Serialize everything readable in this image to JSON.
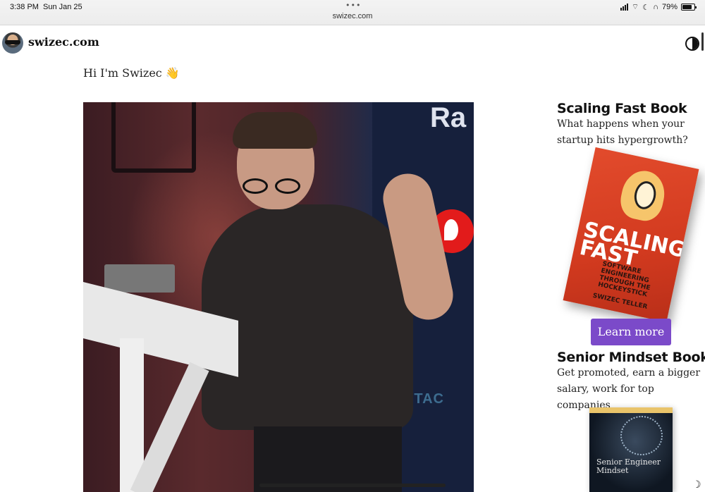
{
  "statusbar": {
    "time": "3:38 PM",
    "date": "Sun Jan 25",
    "dots": "•••",
    "url": "swizec.com",
    "battery_percent": "79%",
    "battery_level": 0.79
  },
  "header": {
    "site_name": "swizec.com",
    "avatar_icon": "avatar-photo",
    "theme_icon": "contrast-toggle-icon"
  },
  "main": {
    "greeting": "Hi I'm Swizec 👋",
    "hero_photo_text": {
      "ra": "Ra",
      "stack": "STAC"
    }
  },
  "sidebar": {
    "books": [
      {
        "title": "Scaling Fast Book",
        "description": "What happens when your startup hits hypergrowth?",
        "cover_title": "SCALING FAST",
        "cover_subtitle": "SOFTWARE ENGINEERING THROUGH THE HOCKEYSTICK",
        "cover_author": "SWIZEC TELLER",
        "cta": "Learn more"
      },
      {
        "title": "Senior Mindset Book",
        "description": "Get promoted, earn a bigger salary, work for top companies",
        "cover_title": "Senior Engineer Mindset"
      }
    ]
  },
  "colors": {
    "cta": "#7b4ac9",
    "scaling_cover": "#d23a1f"
  }
}
